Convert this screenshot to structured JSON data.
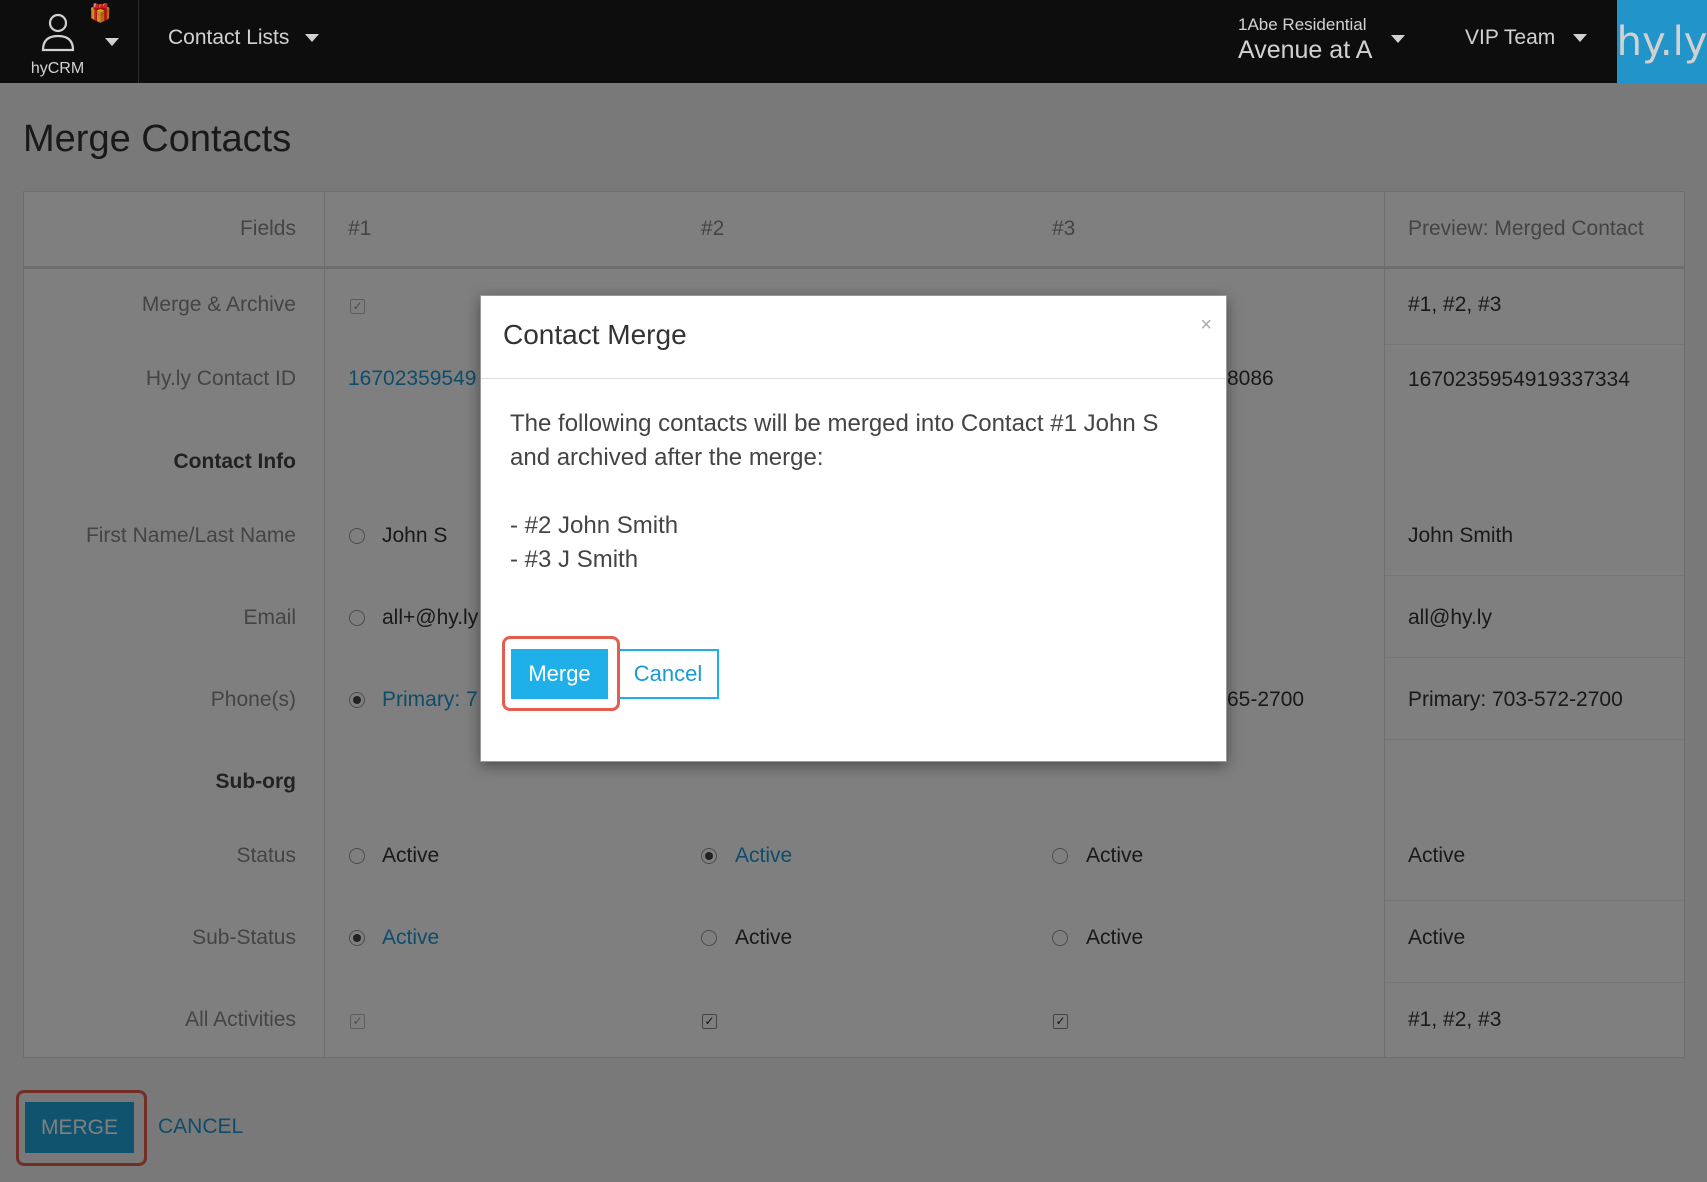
{
  "topbar": {
    "user_label": "hyCRM",
    "contact_lists": "Contact Lists",
    "property_sub": "1Abe Residential",
    "property_main": "Avenue at A",
    "team": "VIP Team",
    "logo": "hy.ly"
  },
  "page": {
    "title": "Merge Contacts",
    "headers": {
      "fields": "Fields",
      "c1": "#1",
      "c2": "#2",
      "c3": "#3",
      "preview": "Preview: Merged Contact"
    },
    "rows": {
      "merge_archive": {
        "label": "Merge & Archive",
        "preview": "#1, #2, #3"
      },
      "contact_id": {
        "label": "Hy.ly Contact ID",
        "c1": "16702359549",
        "c3": "8086",
        "preview": "1670235954919337334"
      },
      "contact_info": {
        "label": "Contact Info"
      },
      "name": {
        "label": "First Name/Last Name",
        "c1": "John S",
        "preview": "John Smith"
      },
      "email": {
        "label": "Email",
        "c1": "all+@hy.ly",
        "preview": "all@hy.ly"
      },
      "phone": {
        "label": "Phone(s)",
        "c1": "Primary: 7",
        "c3": "65-2700",
        "preview": "Primary: 703-572-2700"
      },
      "suborg": {
        "label": "Sub-org"
      },
      "status": {
        "label": "Status",
        "c1": "Active",
        "c2": "Active",
        "c3": "Active",
        "preview": "Active"
      },
      "substatus": {
        "label": "Sub-Status",
        "c1": "Active",
        "c2": "Active",
        "c3": "Active",
        "preview": "Active"
      },
      "activities": {
        "label": "All Activities",
        "preview": "#1, #2, #3"
      }
    },
    "merge_button": "MERGE",
    "cancel_button": "CANCEL"
  },
  "modal": {
    "title": "Contact Merge",
    "close": "×",
    "body_line": "The following contacts will be merged into Contact #1 John S and archived after the merge:",
    "items": [
      "- #2 John Smith",
      "- #3 J Smith"
    ],
    "merge": "Merge",
    "cancel": "Cancel"
  }
}
